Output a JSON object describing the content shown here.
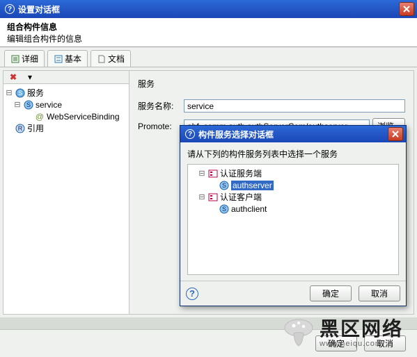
{
  "window": {
    "title": "设置对话框",
    "close_icon": "close-icon"
  },
  "header": {
    "title": "组合构件信息",
    "subtitle": "编辑组合构件的信息"
  },
  "tabs": {
    "detail": "详细",
    "basic": "基本",
    "doc": "文档"
  },
  "tree": {
    "services": "服务",
    "service": "service",
    "binding": "WebServiceBinding",
    "reference": "引用"
  },
  "panel": {
    "section": "服务",
    "name_label": "服务名称:",
    "name_value": "service",
    "promote_label": "Promote:",
    "promote_value": "abf_comm.auth.authServerCom/authserver",
    "browse_btn": "浏览..."
  },
  "footer": {
    "ok": "确定",
    "cancel": "取消"
  },
  "modal": {
    "title": "构件服务选择对话框",
    "instruction": "请从下列的构件服务列表中选择一个服务",
    "node_auth_server": "认证服务端",
    "authserver": "authserver",
    "node_auth_client": "认证客户端",
    "authclient": "authclient",
    "ok": "确定",
    "cancel": "取消"
  },
  "watermark": {
    "text": "黑区网络",
    "url": "www.heiqu.com"
  }
}
